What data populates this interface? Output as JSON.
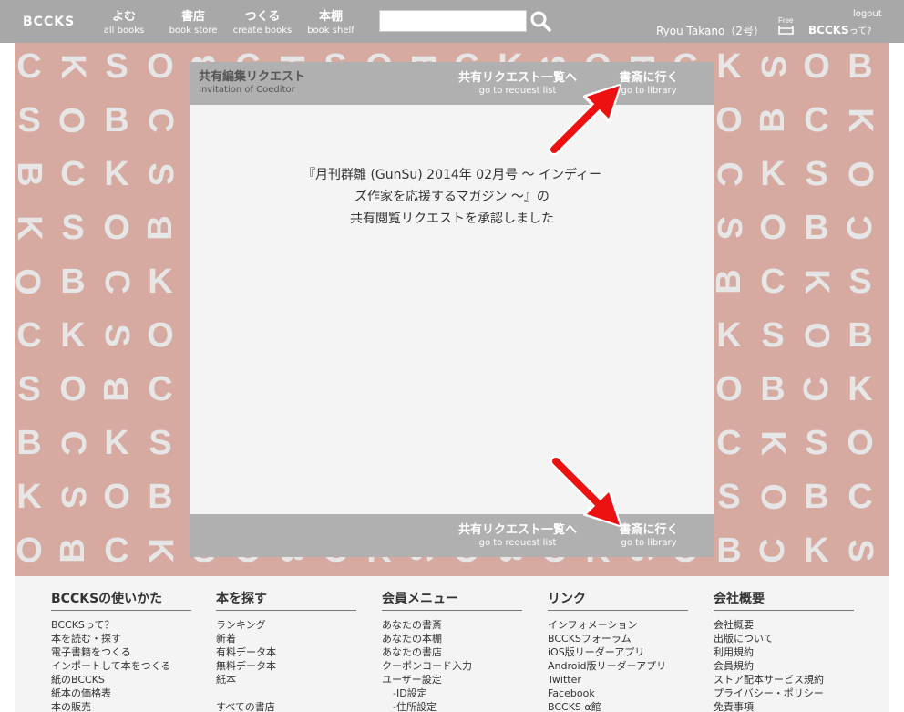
{
  "header": {
    "logo": "BCCKS",
    "nav": [
      {
        "jp": "よむ",
        "en": "all books"
      },
      {
        "jp": "書店",
        "en": "book store"
      },
      {
        "jp": "つくる",
        "en": "create books"
      },
      {
        "jp": "本棚",
        "en": "book shelf"
      }
    ],
    "search_value": "",
    "user_name": "Ryou Takano（2号）",
    "free_label": "Free",
    "logout": "logout",
    "about_main": "BCCKS",
    "about_suffix": "って?"
  },
  "dialog": {
    "title_jp": "共有編集リクエスト",
    "title_en": "Invitation of Coeditor",
    "request_list_jp": "共有リクエスト一覧へ",
    "request_list_en": "go to request list",
    "library_jp": "書斎に行く",
    "library_en": "go to library",
    "message_lines": [
      "『月刊群雛 (GunSu) 2014年 02月号 ～ インディー",
      "ズ作家を応援するマガジン ～』の",
      "共有閲覧リクエストを承認しました"
    ]
  },
  "footer": {
    "columns": [
      {
        "title": "BCCKSの使いかた",
        "items": [
          "BCCKSって？",
          "本を読む・探す",
          "電子書籍をつくる",
          "インポートして本をつくる",
          "紙のBCCKS",
          "紙本の価格表",
          "本の販売"
        ]
      },
      {
        "title": "本を探す",
        "items": [
          "ランキング",
          "新着",
          "有料データ本",
          "無料データ本",
          "紙本",
          "すべての書店"
        ]
      },
      {
        "title": "会員メニュー",
        "items": [
          "あなたの書斎",
          "あなたの本棚",
          "あなたの書店",
          "クーポンコード入力",
          "ユーザー設定",
          "-ID設定",
          "-住所設定"
        ]
      },
      {
        "title": "リンク",
        "items": [
          "インフォメーション",
          "BCCKSフォーラム",
          "iOS版リーダーアプリ",
          "Android版リーダーアプリ",
          "Twitter",
          "Facebook",
          "BCCKS α館"
        ]
      },
      {
        "title": "会社概要",
        "items": [
          "会社概要",
          "出版について",
          "利用規約",
          "会員規約",
          "ストア配本サービス規約",
          "プライバシー・ポリシー",
          "免責事項"
        ]
      }
    ]
  },
  "colors": {
    "header_bg": "#a8a8a8",
    "pattern_bg": "#d6aaa0",
    "pattern_glyph": "#e6e6e6",
    "dialog_bar": "#b0b0b0",
    "dialog_body": "#f3f4f3",
    "arrow": "#ee1111"
  },
  "pattern_glyphs": [
    "C",
    "K",
    "S",
    "O",
    "B"
  ]
}
